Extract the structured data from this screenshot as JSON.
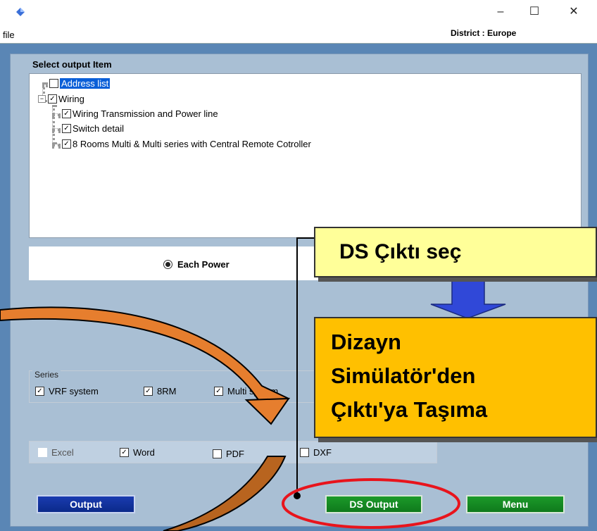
{
  "window": {
    "minimize_glyph": "–",
    "maximize_glyph": "☐",
    "close_glyph": "✕",
    "icon": "diamond-app-icon"
  },
  "menu": {
    "file_label": "file",
    "district_label": "District : Europe"
  },
  "tree": {
    "heading": "Select output Item",
    "items": [
      {
        "label": "Address list",
        "checked": false,
        "selected": true
      },
      {
        "label": "Wiring",
        "checked": true,
        "expander": "⊟"
      },
      {
        "label": "Wiring Transmission and Power line",
        "checked": true
      },
      {
        "label": "Switch detail",
        "checked": true
      },
      {
        "label": "8 Rooms Multi & Multi series with Central Remote Cotroller",
        "checked": true
      }
    ]
  },
  "mode": {
    "each_power_label": "Each Power"
  },
  "series": {
    "label": "Series",
    "vrf_label": "VRF system",
    "rm8_label": "8RM",
    "multi_label": "Multi system"
  },
  "formats": {
    "excel_label": "Excel",
    "word_label": "Word",
    "pdf_label": "PDF",
    "dxf_label": "DXF"
  },
  "buttons": {
    "output_label": "Output",
    "ds_output_label": "DS Output",
    "menu_label": "Menu"
  },
  "annotations": {
    "callout1_text": "DS Çıktı seç",
    "callout2_lines": [
      "Dizayn",
      "Simülatör'den",
      "Çıktı'ya Taşıma"
    ]
  },
  "colors": {
    "frame": "#5a86b5",
    "panel": "#a9bfd4",
    "callout1": "#ffff99",
    "callout2": "#ffc000",
    "highlight_ring": "#e8141c",
    "arrow_orange": "#e67e2e",
    "arrow_brown": "#b8641f",
    "arrow_blue": "#3048d8"
  }
}
